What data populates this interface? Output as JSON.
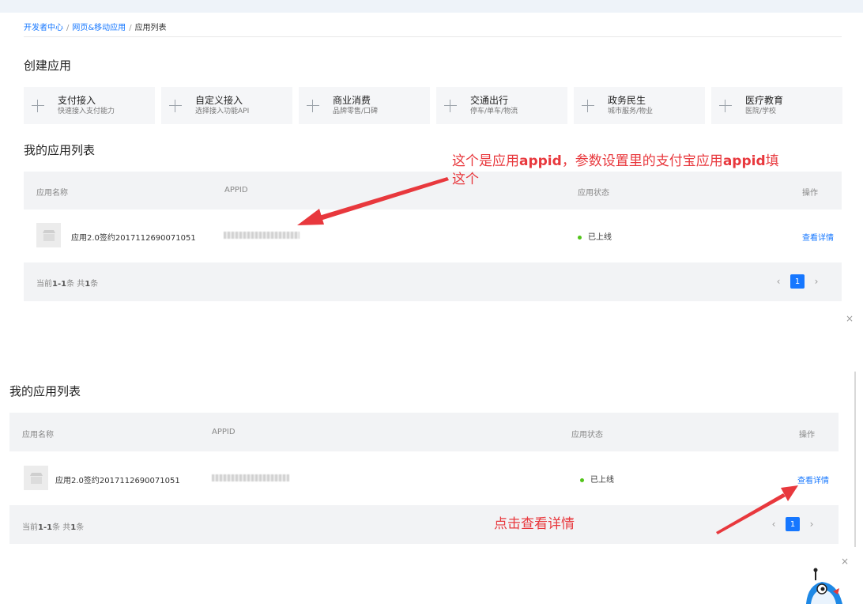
{
  "breadcrumb": {
    "items": [
      "开发者中心",
      "网页&移动应用"
    ],
    "current": "应用列表",
    "sep": "/"
  },
  "create_section": {
    "title": "创建应用",
    "cards": [
      {
        "title": "支付接入",
        "subtitle": "快速接入支付能力"
      },
      {
        "title": "自定义接入",
        "subtitle": "选择接入功能API"
      },
      {
        "title": "商业消费",
        "subtitle": "品牌零售/口碑"
      },
      {
        "title": "交通出行",
        "subtitle": "停车/单车/物流"
      },
      {
        "title": "政务民生",
        "subtitle": "城市服务/物业"
      },
      {
        "title": "医疗教育",
        "subtitle": "医院/学校"
      }
    ]
  },
  "list_top": {
    "title": "我的应用列表",
    "columns": {
      "name": "应用名称",
      "appid": "APPID",
      "status": "应用状态",
      "action": "操作"
    },
    "row": {
      "name": "应用2.0签约2017112690071051",
      "status": "已上线",
      "action": "查看详情"
    },
    "footer": {
      "prefix": "当前",
      "range": "1-1",
      "mid": "条 共",
      "total": "1",
      "suffix": "条"
    },
    "page": "1"
  },
  "list_bottom": {
    "title": "我的应用列表",
    "columns": {
      "name": "应用名称",
      "appid": "APPID",
      "status": "应用状态",
      "action": "操作"
    },
    "row": {
      "name": "应用2.0签约2017112690071051",
      "status": "已上线",
      "action": "查看详情"
    },
    "footer": {
      "prefix": "当前",
      "range": "1-1",
      "mid": "条 共",
      "total": "1",
      "suffix": "条"
    },
    "page": "1"
  },
  "annotations": {
    "appid_note_prefix": "这个是应用",
    "appid_note_kw1": "appid",
    "appid_note_mid": "，参数设置里的支付宝应用",
    "appid_note_kw2": "appid",
    "appid_note_end": "填",
    "appid_note_line2": "这个",
    "details_note": "点击查看详情"
  },
  "icons": {
    "close": "×",
    "prev": "‹",
    "next": "›"
  },
  "colors": {
    "accent": "#1677ff",
    "annotation": "#e8383d",
    "online": "#52c41a"
  }
}
